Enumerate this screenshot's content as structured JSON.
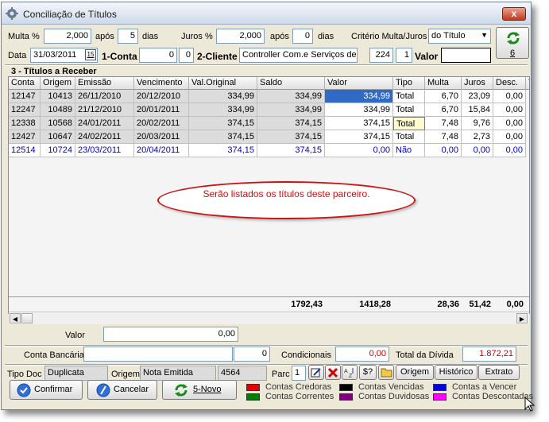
{
  "window": {
    "title": "Conciliação de Títulos",
    "close_label": "x"
  },
  "row1": {
    "multa_label": "Multa %",
    "multa_value": "2,000",
    "apos1_label": "após",
    "apos1_value": "5",
    "dias1_label": "dias",
    "juros_label": "Juros %",
    "juros_value": "2,000",
    "apos2_label": "após",
    "apos2_value": "0",
    "dias2_label": "dias",
    "criterio_label": "Critério Multa/Juros",
    "criterio_value": "do Título"
  },
  "row2": {
    "data_label": "Data",
    "data_value": "31/03/2011",
    "calendar_value": "15",
    "conta_label": "1-Conta",
    "conta_value": "0",
    "conta_extra": "0",
    "cliente_label": "2-Cliente",
    "cliente_value": "Controller Com.e Serviços de F",
    "cliente_code": "224",
    "cliente_extra": "1",
    "valor_label": "Valor",
    "valor_value": ""
  },
  "refresh": {
    "count": "6"
  },
  "section": {
    "title": "3 - Títulos a Receber"
  },
  "grid": {
    "headers": [
      "Conta",
      "Origem",
      "Emissão",
      "Vencimento",
      "Val.Original",
      "Saldo",
      "Valor",
      "Tipo",
      "Multa",
      "Juros",
      "Desc.",
      "T"
    ],
    "rows": [
      [
        "12147",
        "10413",
        "26/11/2010",
        "20/12/2010",
        "334,99",
        "334,99",
        "334,99",
        "Total",
        "6,70",
        "23,09",
        "0,00"
      ],
      [
        "12247",
        "10489",
        "21/12/2010",
        "20/01/2011",
        "334,99",
        "334,99",
        "334,99",
        "Total",
        "6,70",
        "15,84",
        "0,00"
      ],
      [
        "12338",
        "10568",
        "24/01/2011",
        "20/02/2011",
        "374,15",
        "374,15",
        "374,15",
        "Total",
        "7,48",
        "9,76",
        "0,00"
      ],
      [
        "12427",
        "10647",
        "24/02/2011",
        "20/03/2011",
        "374,15",
        "374,15",
        "374,15",
        "Total",
        "7,48",
        "2,73",
        "0,00"
      ],
      [
        "12514",
        "10724",
        "23/03/2011",
        "20/04/2011",
        "374,15",
        "374,15",
        "0,00",
        "Não",
        "0,00",
        "0,00",
        "0,00"
      ]
    ],
    "totals": {
      "saldo": "1792,43",
      "valor": "1418,28",
      "multa": "28,36",
      "juros": "51,42",
      "desc": "0,00"
    }
  },
  "callout": {
    "text": "Serão listados os títulos deste parceiro."
  },
  "bottom": {
    "valor_label": "Valor",
    "valor_value": "0,00",
    "conta_bancaria_label": "Conta Bancária",
    "conta_bancaria_value": "",
    "conta_bancaria_num": "0",
    "condicionais_label": "Condicionais",
    "condicionais_value": "0,00",
    "total_divida_label": "Total da Dívida",
    "total_divida_value": "1.872,21",
    "tipo_doc_label": "Tipo Doc",
    "tipo_doc_value": "Duplicata",
    "origem_label": "Origem",
    "origem_value": "Nota Emitida",
    "origem_num": "4564",
    "parc_label": "Parc",
    "parc_value": "1",
    "dollar_label": "$?",
    "origem_btn": "Origem",
    "historico_btn": "Histórico",
    "extrato_btn": "Extrato"
  },
  "actions": {
    "confirmar": "Confirmar",
    "cancelar": "Cancelar",
    "novo": "5-Novo"
  },
  "legend": [
    {
      "label": "Contas Credoras",
      "color": "#e00000"
    },
    {
      "label": "Contas Vencidas",
      "color": "#000000"
    },
    {
      "label": "Contas a Vencer",
      "color": "#0000e0"
    },
    {
      "label": "Contas Correntes",
      "color": "#008000"
    },
    {
      "label": "Contas Duvidosas",
      "color": "#800080"
    },
    {
      "label": "Contas Descontadas",
      "color": "#ff00ff"
    }
  ]
}
